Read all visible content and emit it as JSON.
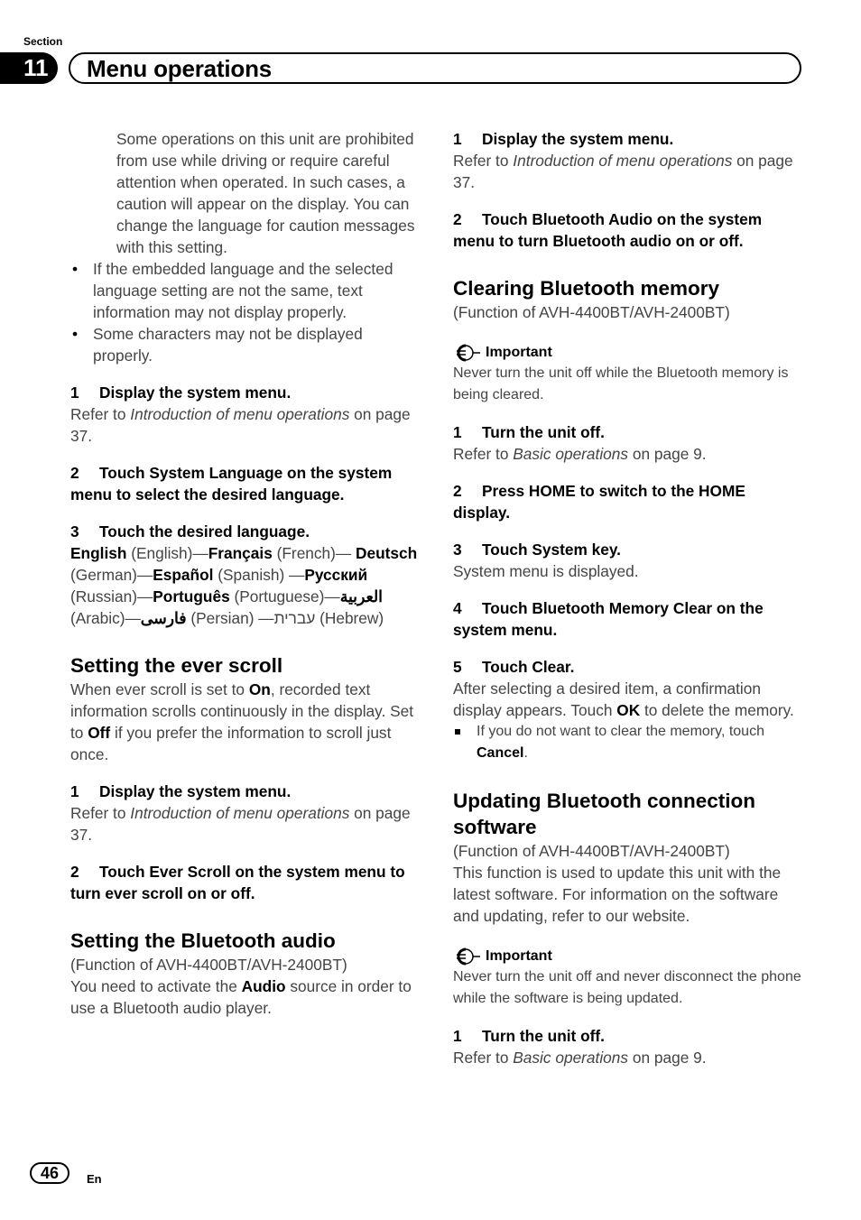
{
  "header": {
    "section_label": "Section",
    "section_number": "11",
    "title": "Menu operations"
  },
  "left": {
    "intro_para": "Some operations on this unit are prohibited from use while driving or require careful attention when operated. In such cases, a caution will appear on the display. You can change the language for caution messages with this setting.",
    "bullets": [
      "If the embedded language and the selected language setting are not the same, text information may not display properly.",
      "Some characters may not be displayed properly."
    ],
    "lang_steps": {
      "step1": {
        "num": "1",
        "text": "Display the system menu."
      },
      "step1_ref": {
        "prefix": "Refer to ",
        "link": "Introduction of menu operations",
        "suffix": " on page 37."
      },
      "step2": {
        "num": "2",
        "text": "Touch System Language on the system menu to select the desired language."
      },
      "step3": {
        "num": "3",
        "text": "Touch the desired language."
      },
      "languages": [
        {
          "native": "English",
          "english": "(English)"
        },
        {
          "native": "Français",
          "english": "(French)"
        },
        {
          "native": "Deutsch",
          "english": "(German)"
        },
        {
          "native": "Español",
          "english": "(Spanish)"
        },
        {
          "native": "Русский",
          "english": "(Russian)"
        },
        {
          "native": "Português",
          "english": "(Portuguese)"
        },
        {
          "native": "العربية",
          "english": "(Arabic)"
        },
        {
          "native": "فارسی",
          "english": "(Persian)"
        },
        {
          "native": "עברית",
          "english": "(Hebrew)"
        }
      ]
    },
    "ever_scroll": {
      "heading": "Setting the ever scroll",
      "desc": {
        "p1": "When ever scroll is set to ",
        "on": "On",
        "p2": ", recorded text information scrolls continuously in the display. Set to ",
        "off": "Off",
        "p3": " if you prefer the information to scroll just once."
      },
      "step1": {
        "num": "1",
        "text": "Display the system menu."
      },
      "step1_ref": {
        "prefix": "Refer to ",
        "link": "Introduction of menu operations",
        "suffix": " on page 37."
      },
      "step2": {
        "num": "2",
        "text": "Touch Ever Scroll on the system menu to turn ever scroll on or off."
      }
    },
    "bt_audio": {
      "heading": "Setting the Bluetooth audio",
      "function_note": "(Function of AVH-4400BT/AVH-2400BT)",
      "desc": {
        "p1": "You need to activate the ",
        "bold": "Audio",
        "p2": " source in order to use a Bluetooth audio player."
      }
    }
  },
  "right": {
    "bt_audio_steps": {
      "step1": {
        "num": "1",
        "text": "Display the system menu."
      },
      "step1_ref": {
        "prefix": "Refer to ",
        "link": "Introduction of menu operations",
        "suffix": " on page 37."
      },
      "step2": {
        "num": "2",
        "text": "Touch Bluetooth Audio on the system menu to turn Bluetooth audio on or off."
      }
    },
    "clear_memory": {
      "heading": "Clearing Bluetooth memory",
      "function_note": "(Function of AVH-4400BT/AVH-2400BT)",
      "important_label": "Important",
      "important_text": "Never turn the unit off while the Bluetooth memory is being cleared.",
      "step1": {
        "num": "1",
        "text": "Turn the unit off."
      },
      "step1_ref": {
        "prefix": "Refer to ",
        "link": "Basic operations",
        "suffix": " on page 9."
      },
      "step2": {
        "num": "2",
        "text": "Press HOME to switch to the HOME display."
      },
      "step3": {
        "num": "3",
        "text": "Touch System key."
      },
      "step3_desc": "System menu is displayed.",
      "step4": {
        "num": "4",
        "text": "Touch Bluetooth Memory Clear on the system menu."
      },
      "step5": {
        "num": "5",
        "text": "Touch Clear."
      },
      "step5_desc": {
        "p1": "After selecting a desired item, a confirmation display appears. Touch ",
        "bold": "OK",
        "p2": " to delete the memory."
      },
      "note": {
        "p1": "If you do not want to clear the memory, touch ",
        "bold": "Cancel",
        "p2": "."
      }
    },
    "update_sw": {
      "heading": "Updating Bluetooth connection software",
      "function_note": "(Function of AVH-4400BT/AVH-2400BT)",
      "desc": "This function is used to update this unit with the latest software. For information on the software and updating, refer to our website.",
      "important_label": "Important",
      "important_text": "Never turn the unit off and never disconnect the phone while the software is being updated.",
      "step1": {
        "num": "1",
        "text": "Turn the unit off."
      },
      "step1_ref": {
        "prefix": "Refer to ",
        "link": "Basic operations",
        "suffix": " on page 9."
      }
    }
  },
  "footer": {
    "page_number": "46",
    "language": "En"
  }
}
